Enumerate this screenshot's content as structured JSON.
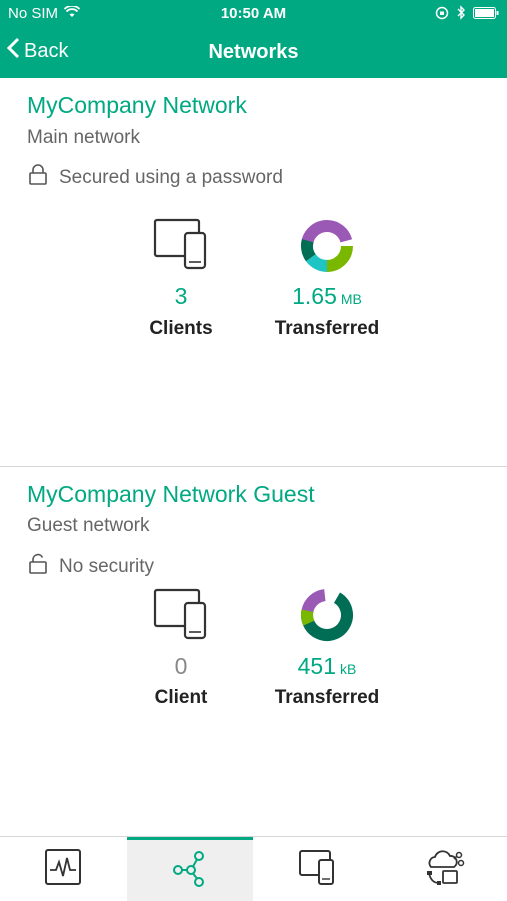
{
  "status_bar": {
    "carrier": "No SIM",
    "time": "10:50 AM"
  },
  "nav": {
    "back_label": "Back",
    "title": "Networks"
  },
  "networks": [
    {
      "name": "MyCompany Network",
      "type": "Main network",
      "security": "Secured using a password",
      "clients_value": "3",
      "clients_label": "Clients",
      "transferred_value": "1.65",
      "transferred_unit": "MB",
      "transferred_label": "Transferred"
    },
    {
      "name": "MyCompany Network Guest",
      "type": "Guest network",
      "security": "No security",
      "clients_value": "0",
      "clients_label": "Client",
      "transferred_value": "451",
      "transferred_unit": "kB",
      "transferred_label": "Transferred"
    }
  ],
  "tabs": [
    {
      "icon": "activity-monitor-icon",
      "active": false
    },
    {
      "icon": "network-nodes-icon",
      "active": true
    },
    {
      "icon": "devices-icon",
      "active": false
    },
    {
      "icon": "cloud-services-icon",
      "active": false
    }
  ],
  "colors": {
    "accent": "#01a982",
    "purple": "#9b59b6",
    "green": "#7ab800",
    "teal": "#1fc5c5",
    "dark_green": "#006d55"
  }
}
